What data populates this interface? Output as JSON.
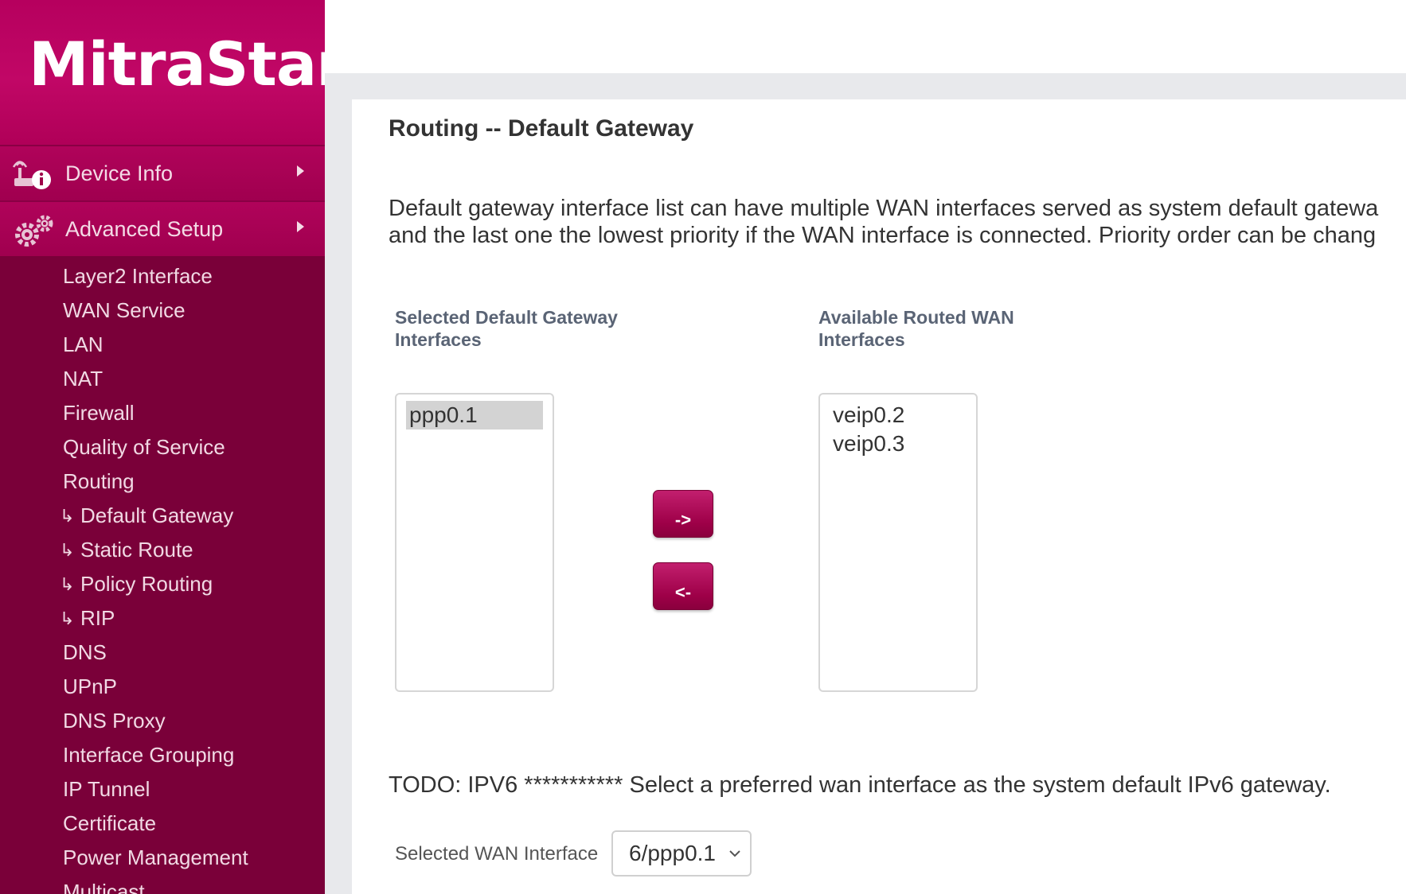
{
  "brand": {
    "logo_text": "MitraStar"
  },
  "sidebar": {
    "top_items": [
      {
        "label": "Device Info",
        "icon": "device-info-icon"
      },
      {
        "label": "Advanced Setup",
        "icon": "gears-icon"
      }
    ],
    "sub_items": [
      {
        "label": "Layer2 Interface"
      },
      {
        "label": "WAN Service"
      },
      {
        "label": "LAN"
      },
      {
        "label": "NAT"
      },
      {
        "label": "Firewall"
      },
      {
        "label": "Quality of Service"
      },
      {
        "label": "Routing"
      },
      {
        "label": "Default Gateway",
        "branch": "↳"
      },
      {
        "label": "Static Route",
        "branch": "↳"
      },
      {
        "label": "Policy Routing",
        "branch": "↳"
      },
      {
        "label": "RIP",
        "branch": "↳"
      },
      {
        "label": "DNS"
      },
      {
        "label": "UPnP"
      },
      {
        "label": "DNS Proxy"
      },
      {
        "label": "Interface Grouping"
      },
      {
        "label": "IP Tunnel"
      },
      {
        "label": "Certificate"
      },
      {
        "label": "Power Management"
      },
      {
        "label": "Multicast"
      }
    ]
  },
  "main": {
    "title": "Routing -- Default Gateway",
    "description_line1": "Default gateway interface list can have multiple WAN interfaces served as system default gatewa",
    "description_line2": "and the last one the lowest priority if the WAN interface is connected. Priority order can be chang",
    "selected_header_line1": "Selected Default Gateway",
    "selected_header_line2": "Interfaces",
    "available_header_line1": "Available Routed WAN",
    "available_header_line2": "Interfaces",
    "selected_interfaces": [
      "ppp0.1"
    ],
    "available_interfaces": [
      "veip0.2",
      "veip0.3"
    ],
    "move_right_label": "->",
    "move_left_label": "<-",
    "ipv6_note": "TODO: IPV6 *********** Select a preferred wan interface as the system default IPv6 gateway.",
    "wan_interface_label": "Selected WAN Interface",
    "wan_interface_value": "6/ppp0.1"
  }
}
